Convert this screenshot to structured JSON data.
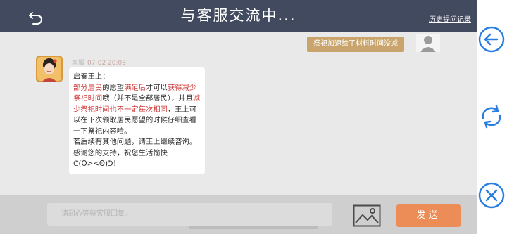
{
  "header": {
    "title": "与客服交流中...",
    "history_link": "历史提问记录",
    "back_icon": "back-arrow-icon"
  },
  "chat": {
    "user_message": "祭祀加速给了材料时间没减",
    "agent": {
      "role": "客服",
      "timestamp": "07-02 20:03",
      "lines": {
        "l1": "启奏王上：",
        "s1": "部分居民",
        "s2": "的愿望",
        "s3": "满足后",
        "s4": "才可以",
        "s5": "获得减少祭祀时间",
        "s6": "哦（并不是全部居民），并且",
        "s7": "减少祭祀时间也不一定每次相同",
        "s8": "，王上可以在下次领取居民愿望的时候仔细查看一下祭祀内容哈。",
        "l2": "若后续有其他问题，请王上继续咨询。",
        "l3": "感谢您的支持，祝您生活愉快",
        "l4": "ᕦ(ʘ><ʘ)ᕤ！"
      }
    }
  },
  "composer": {
    "placeholder": "请耐心等待客服回复。",
    "send_label": "发送",
    "image_icon": "image-icon"
  },
  "side_controls": {
    "icons": [
      "arrow-left-circle-icon",
      "refresh-icon",
      "close-circle-icon"
    ],
    "accent_color": "#2a7de1"
  },
  "colors": {
    "header_bg": "#414a5e",
    "user_bubble": "#c9a56d",
    "highlight_red": "#cf3a3a",
    "send_button": "#ec8c57"
  }
}
